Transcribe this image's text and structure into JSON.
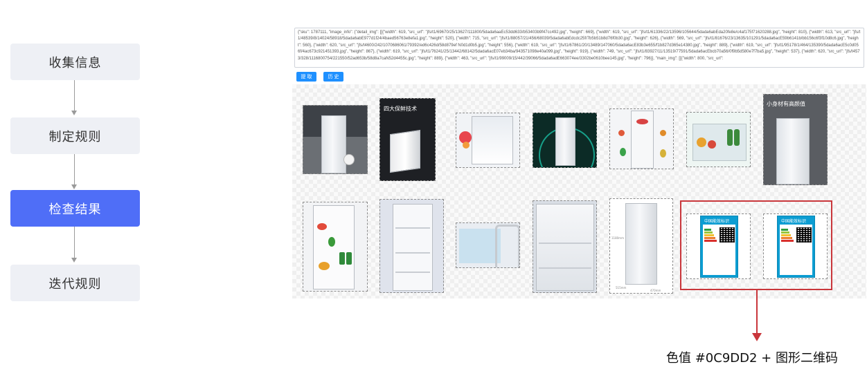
{
  "flow": {
    "steps": [
      {
        "label": "收集信息",
        "active": false
      },
      {
        "label": "制定规则",
        "active": false
      },
      {
        "label": "检查结果",
        "active": true
      },
      {
        "label": "迭代规则",
        "active": false
      }
    ]
  },
  "json_text": "{\"sku\": 1787111, \"image_info\": {\"detail_img\": [[{\"width\": 619, \"src_url\": \"jfs/t1/69670/25/13627/111800/5dada6aaEc53dd633/b53403b9f47cc492.jpg\", \"height\": 669}, {\"width\": 619, \"src_url\": \"jfs/t1/61336/22/13596/105644/5dada6abEda20fe8e/c4af175f71620288.jpg\", \"height\": 810}, {\"width\": 613, \"src_url\": \"jfs/t1/48539/8/14024/58918/5dada6abE977d1f24/4baed56763e8efa1.jpg\", \"height\": 520}, {\"width\": 715, \"src_url\": \"jfs/t1/88057/21/456/68039/5dada6abEdcdc25f/7b5b51b8d76f0b30.jpg\", \"height\": 626}, {\"width\": 569, \"src_url\": \"jfs/t1/81676/23/13635/101291/5dada6acE59b6141b/bb156c6f3f10d8c6.jpg\", \"height\": 560}, {\"width\": 620, \"src_url\": \"jfs/t4600/242/1070686061/79392/ed6c426d/58d879ef N0d1d0b5.jpg\", \"height\": 556}, {\"width\": 619, \"src_url\": \"jfs/t1/67861/20/13489/147060/5dada6acE83b3e655/f1b827d365e14380.jpg\", \"height\": 889}, {\"width\": 619, \"src_url\": \"jfs/t1/95178/1/464/135390/5dada6acE5c0d056f/4ac673c921451393.jpg\", \"height\": 867}, {\"width\": 619, \"src_url\": \"jfs/t1/76241/25/13442/68142/5dada6acE07eb34ba/943571098e40a099.jpg\", \"height\": 919}, {\"width\": 749, \"src_url\": \"jfs/t1/83927/11/13519/77591/5dada6acEbcb70a56/0f9b5d580e7f7ba5.jpg\", \"height\": 537}, {\"width\": 620, \"src_url\": \"jfs/t4573/328/1116800754/221550/52ad653b/58d8a7caN52d4455c.jpg\", \"height\": 889}, {\"width\": 463, \"src_url\": \"jfs/t1/99009/15/442/39066/5dada6adE663074ee/3302be0610bee145.jpg\", \"height\": 796}], \"main_img\": [[{\"width\": 800, \"src_url\":",
  "buttons": {
    "submit": "提 取",
    "history": "历 史"
  },
  "thumb_texts": {
    "t2_title": "四大保鲜技术",
    "t7_title": "小身材有高颜值",
    "t12_top": "中国能效标识",
    "t13_top": "中国能效标识",
    "t11_dim_height": "1180mm",
    "t11_dim_width": "515mm",
    "t11_dim_depth": "470mm"
  },
  "caption": "色值 #0C9DD2 + 图形二维码",
  "colors": {
    "accent": "#4f6ef7",
    "label_blue": "#0C9DD2",
    "highlight_red": "#c9363b",
    "button_blue": "#1e90ff"
  },
  "icons": {
    "flow_arrow": "arrow-down-icon",
    "annotation_arrow": "arrow-down-icon"
  }
}
